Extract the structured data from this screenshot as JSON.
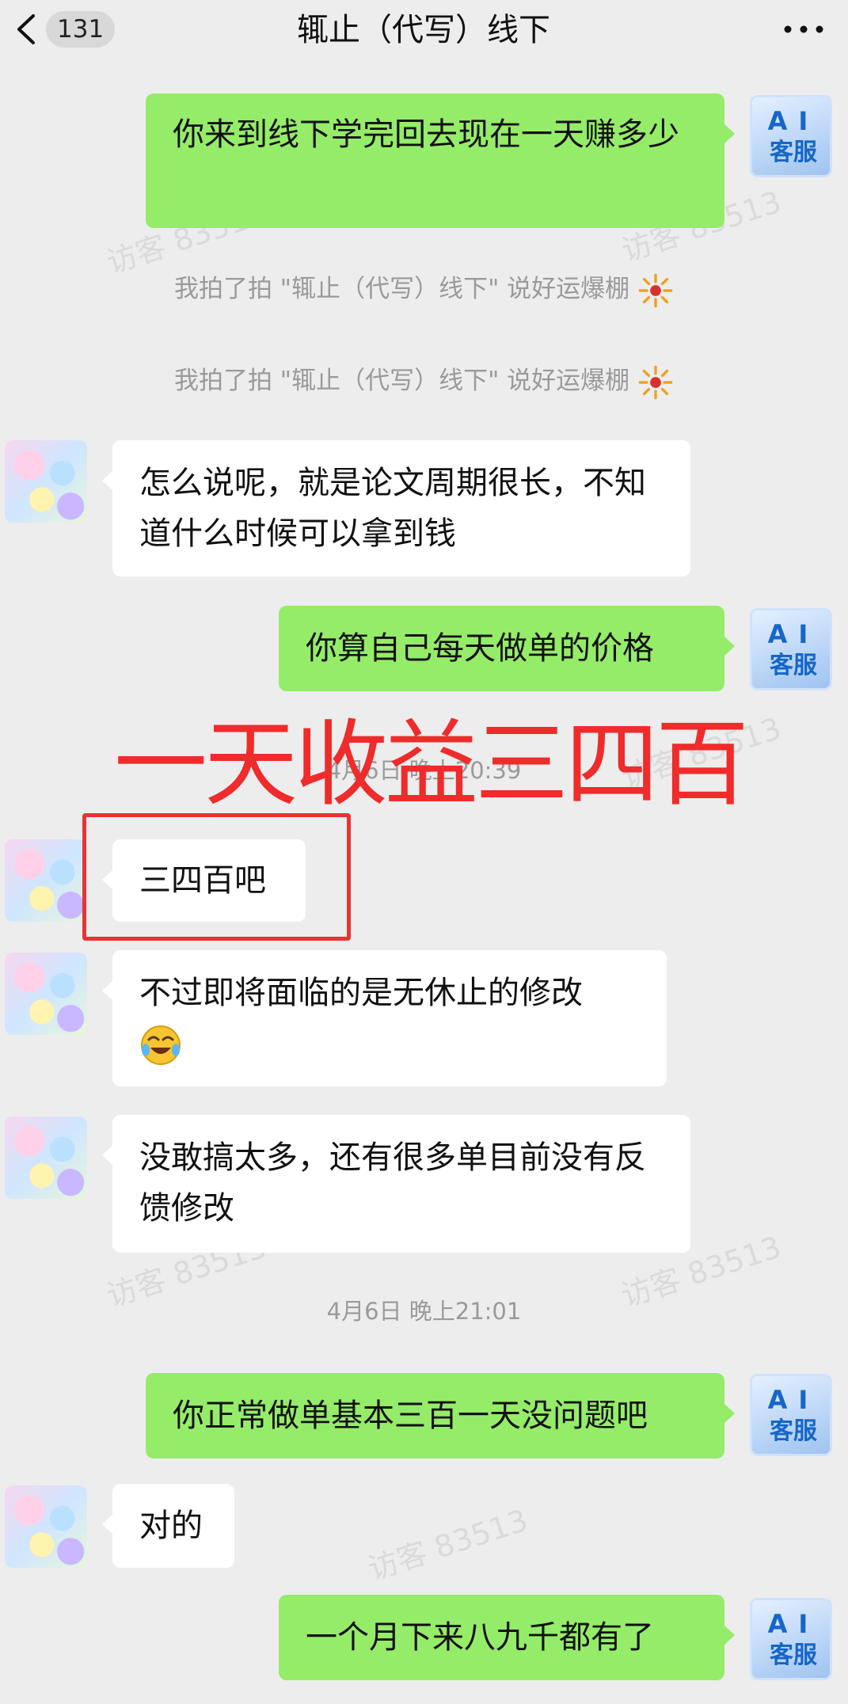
{
  "header": {
    "unread_count": "131",
    "title": "辄止（代写）线下"
  },
  "watermark": "访客 83513",
  "overlay": {
    "caption": "一天收益三四百"
  },
  "messages": {
    "m1": "你来到线下学完回去现在一天赚多少",
    "s1": "我拍了拍 \"辄止（代写）线下\" 说好运爆棚",
    "s2": "我拍了拍 \"辄止（代写）线下\" 说好运爆棚",
    "m2": "怎么说呢，就是论文周期很长，不知道什么时候可以拿到钱",
    "m3": "你算自己每天做单的价格",
    "t1": "4月6日 晚上20:39",
    "m4": "三四百吧",
    "m5": "不过即将面临的是无休止的修改",
    "m6": "没敢搞太多，还有很多单目前没有反馈修改",
    "t2": "4月6日 晚上21:01",
    "m7": "你正常做单基本三百一天没问题吧",
    "m8": "对的",
    "m9": "一个月下来八九千都有了"
  },
  "ai_avatar": {
    "line1": "AI",
    "line2": "客服"
  },
  "icons": {
    "back": "chevron-left-icon",
    "more": "more-dots-icon",
    "celebration": "firecracker-emoji",
    "emoji": "laughing-tears-emoji"
  },
  "colors": {
    "outgoing_bubble": "#95ec69",
    "incoming_bubble": "#ffffff",
    "background": "#ededed",
    "annotation_red": "#e93333"
  }
}
